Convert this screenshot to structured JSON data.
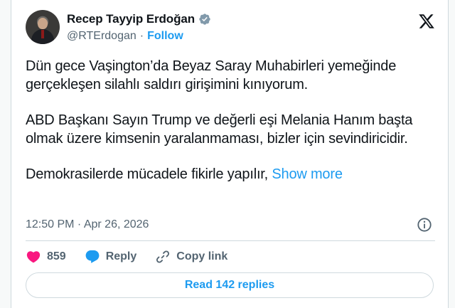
{
  "author": {
    "name": "Recep Tayyip Erdoğan",
    "handle": "@RTErdogan",
    "separator": "·",
    "follow_label": "Follow"
  },
  "tweet": {
    "paragraphs": [
      "Dün gece Vaşington’da Beyaz Saray Muhabirleri yemeğinde gerçekleşen silahlı saldırı girişimini kınıyorum.",
      "ABD Başkanı Sayın Trump ve değerli eşi Melania Hanım başta olmak üzere kimsenin yaralanmaması, bizler için sevindiricidir.",
      "Demokrasilerde mücadele fikirle yapılır,"
    ],
    "show_more_label": "Show more",
    "timestamp": "12:50 PM · Apr 26, 2026"
  },
  "actions": {
    "like_count": "859",
    "reply_label": "Reply",
    "copy_link_label": "Copy link"
  },
  "replies_button_label": "Read 142 replies",
  "colors": {
    "accent": "#1d9bf0",
    "like": "#f91880",
    "text": "#0f1419",
    "muted": "#536471",
    "border": "#cfd9de"
  },
  "icons": {
    "verified": "verified-badge-icon",
    "platform": "x-logo-icon",
    "info": "info-icon",
    "like": "heart-icon",
    "reply": "reply-bubble-icon",
    "copy_link": "link-icon"
  }
}
